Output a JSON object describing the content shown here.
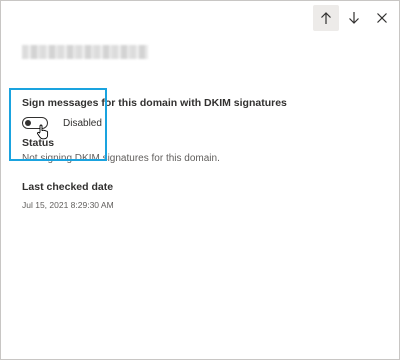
{
  "header": {
    "up_icon": "arrow-up-icon",
    "down_icon": "arrow-down-icon",
    "close_icon": "close-icon"
  },
  "dkim": {
    "sign_label": "Sign messages for this domain with DKIM signatures",
    "toggle_state_text": "Disabled",
    "status_label": "Status",
    "status_text": "Not signing DKIM signatures for this domain."
  },
  "last_checked": {
    "label": "Last checked date",
    "value": "Jul 15, 2021 8:29:30 AM"
  },
  "colors": {
    "highlight": "#1aa3df",
    "text": "#323130",
    "muted": "#605e5c"
  }
}
